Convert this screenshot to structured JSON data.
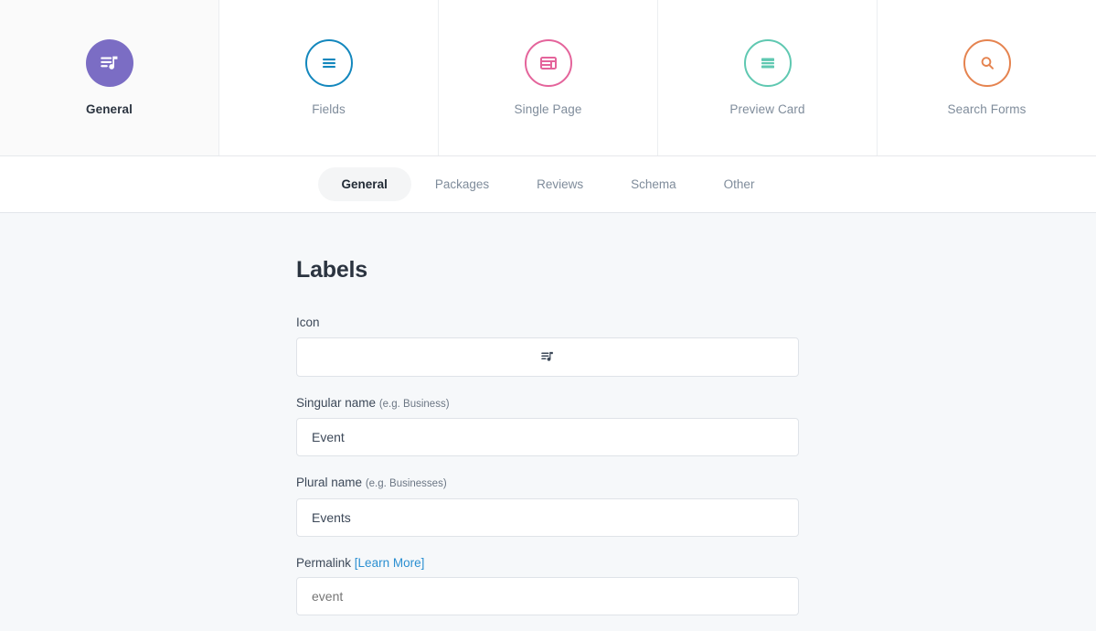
{
  "top_tabs": [
    {
      "label": "General",
      "icon": "playlist-music-icon",
      "color": "#7b6dc4",
      "style": "filled",
      "active": true
    },
    {
      "label": "Fields",
      "icon": "hamburger-list-icon",
      "color": "#1387bd",
      "style": "outline",
      "active": false
    },
    {
      "label": "Single Page",
      "icon": "layout-page-icon",
      "color": "#e4649b",
      "style": "outline",
      "active": false
    },
    {
      "label": "Preview Card",
      "icon": "preview-card-icon",
      "color": "#5fc8b1",
      "style": "outline",
      "active": false
    },
    {
      "label": "Search Forms",
      "icon": "search-icon",
      "color": "#e5834f",
      "style": "outline",
      "active": false
    }
  ],
  "subtabs": [
    {
      "label": "General",
      "active": true
    },
    {
      "label": "Packages",
      "active": false
    },
    {
      "label": "Reviews",
      "active": false
    },
    {
      "label": "Schema",
      "active": false
    },
    {
      "label": "Other",
      "active": false
    }
  ],
  "main": {
    "section_title": "Labels",
    "icon_field": {
      "label": "Icon",
      "icon": "playlist-music-icon"
    },
    "singular_name": {
      "label": "Singular name",
      "hint": "(e.g. Business)",
      "value": "Event"
    },
    "plural_name": {
      "label": "Plural name",
      "hint": "(e.g. Businesses)",
      "value": "Events"
    },
    "permalink": {
      "label": "Permalink",
      "learn_more": "[Learn More]",
      "value": "",
      "placeholder": "event"
    }
  },
  "colors": {
    "page_background": "#f6f8fa",
    "panel_background": "#ffffff",
    "link": "#2b8fd1",
    "text": "#3c4858",
    "muted_text": "#7f8c9b"
  }
}
